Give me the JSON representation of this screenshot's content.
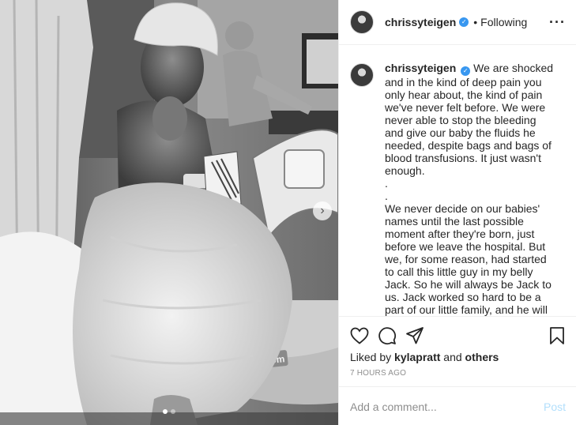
{
  "post": {
    "username": "chrissyteigen",
    "verified_icon": "verified-badge-icon",
    "separator": "•",
    "follow_status": "Following",
    "more_icon": "more-options-icon"
  },
  "caption": {
    "username": "chrissyteigen",
    "text": "We are shocked and in the kind of deep pain you only hear about, the kind of pain we've never felt before. We were never able to stop the bleeding and give our baby the fluids he needed, despite bags and bags of blood transfusions. It just wasn't enough.\n.\n.\nWe never decide on our babies' names until the last possible moment after they're born, just before we leave the hospital.  But we, for some reason, had started to call this little guy in my belly Jack.  So he will always be Jack to us.  Jack worked so hard to be a part of our little family, and he will"
  },
  "photo": {
    "bed_brand": "Hill-Rom",
    "next_icon": "chevron-right-icon",
    "carousel": {
      "count": 2,
      "active": 0
    }
  },
  "actions": {
    "icons": [
      "heart-icon",
      "comment-icon",
      "share-icon",
      "bookmark-icon"
    ],
    "liked_by_prefix": "Liked by",
    "liked_by_user": "kylapratt",
    "liked_by_conj": "and",
    "liked_by_others": "others",
    "timestamp": "7 HOURS AGO",
    "comment_placeholder": "Add a comment...",
    "post_label": "Post"
  },
  "colors": {
    "verified": "#3897f0",
    "post_disabled": "#b2dffc",
    "muted": "#8e8e8e",
    "text": "#262626"
  }
}
